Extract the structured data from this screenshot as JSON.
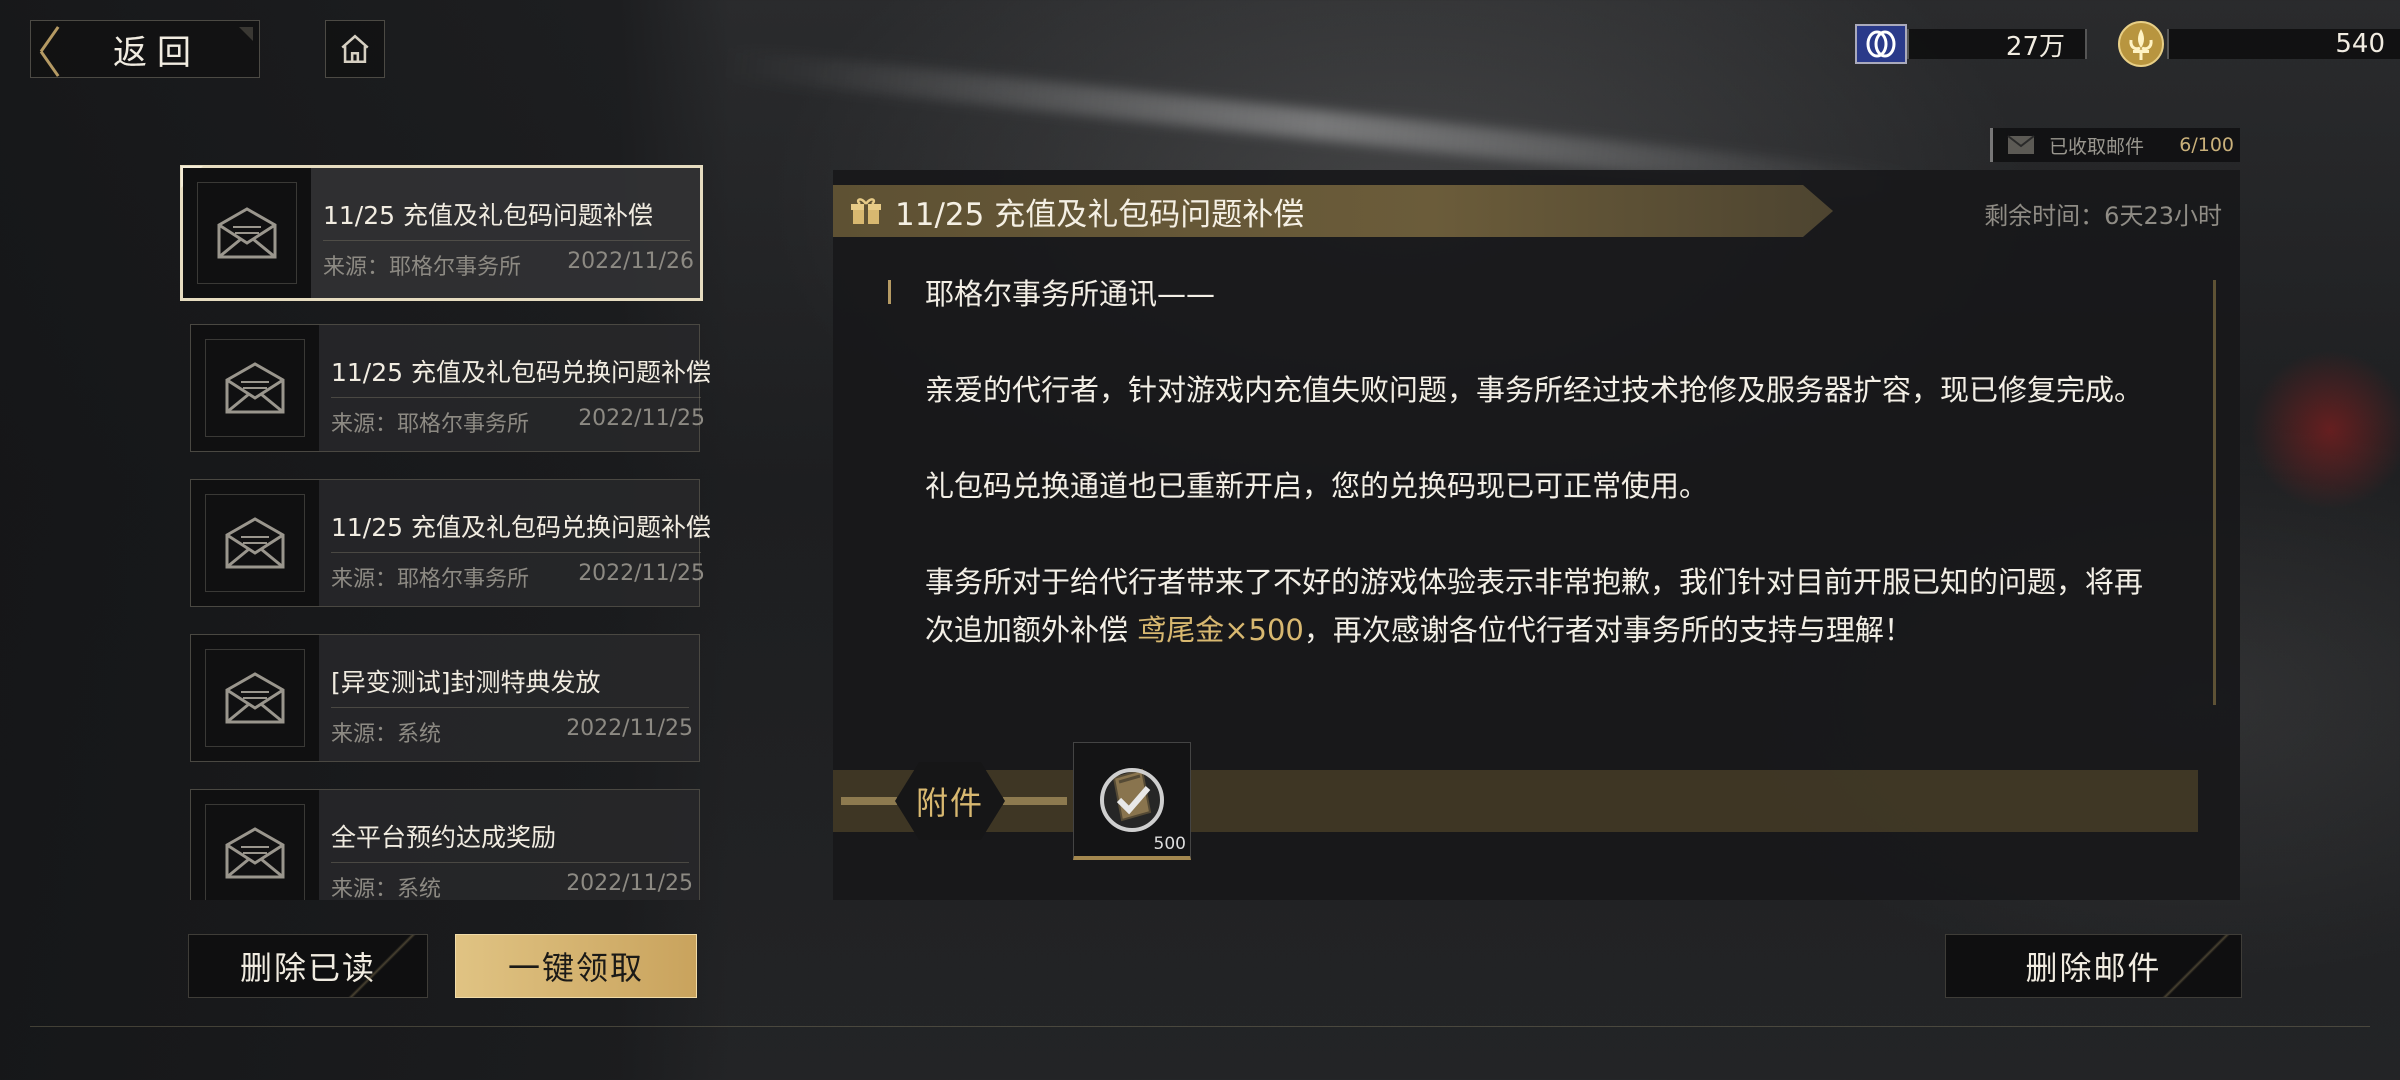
{
  "topbar": {
    "back_label": "返回",
    "currency": [
      {
        "icon": "credits-icon",
        "value": "27万"
      },
      {
        "icon": "fleur-de-lis-coin-icon",
        "value": "540"
      }
    ]
  },
  "mail_counter": {
    "label": "已收取邮件",
    "count": "6/100"
  },
  "mail_list": [
    {
      "title": "11/25 充值及礼包码问题补偿",
      "source": "来源：耶格尔事务所",
      "date": "2022/11/26",
      "selected": true
    },
    {
      "title": "11/25 充值及礼包码兑换问题补偿",
      "source": "来源：耶格尔事务所",
      "date": "2022/11/25",
      "selected": false
    },
    {
      "title": "11/25 充值及礼包码兑换问题补偿",
      "source": "来源：耶格尔事务所",
      "date": "2022/11/25",
      "selected": false
    },
    {
      "title": "[异变测试]封测特典发放",
      "source": "来源：系统",
      "date": "2022/11/25",
      "selected": false
    },
    {
      "title": "全平台预约达成奖励",
      "source": "来源：系统",
      "date": "2022/11/25",
      "selected": false
    }
  ],
  "buttons": {
    "delete_read": "删除已读",
    "claim_all": "一键领取",
    "delete_mail": "删除邮件"
  },
  "detail": {
    "title": "11/25 充值及礼包码问题补偿",
    "remaining": "剩余时间：6天23小时",
    "greeting": "耶格尔事务所通讯——",
    "para1": "亲爱的代行者，针对游戏内充值失败问题，事务所经过技术抢修及服务器扩容，现已修复完成。",
    "para2": "礼包码兑换通道也已重新开启，您的兑换码现已可正常使用。",
    "para3_before": "事务所对于给代行者带来了不好的游戏体验表示非常抱歉，我们针对目前开服已知的问题，将再次追加额外补偿 ",
    "para3_highlight": "鸢尾金×500",
    "para3_after": "，再次感谢各位代行者对事务所的支持与理解！",
    "attachment_label": "附件",
    "attachment_qty": "500"
  }
}
